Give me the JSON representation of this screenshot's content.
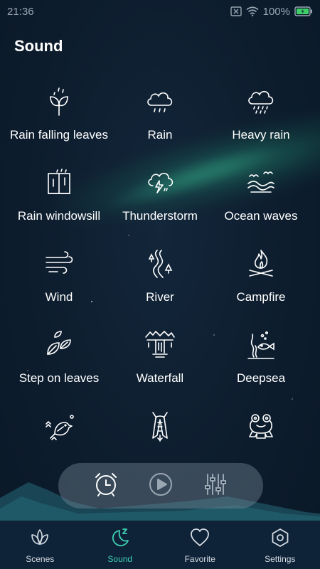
{
  "status_bar": {
    "time": "21:36",
    "battery": "100%"
  },
  "page_title": "Sound",
  "sounds": [
    {
      "label": "Rain falling leaves",
      "icon": "rain-leaves-icon"
    },
    {
      "label": "Rain",
      "icon": "rain-cloud-icon"
    },
    {
      "label": "Heavy rain",
      "icon": "heavy-rain-cloud-icon"
    },
    {
      "label": "Rain windowsill",
      "icon": "window-rain-icon"
    },
    {
      "label": "Thunderstorm",
      "icon": "thunderstorm-icon"
    },
    {
      "label": "Ocean waves",
      "icon": "waves-birds-icon"
    },
    {
      "label": "Wind",
      "icon": "wind-icon"
    },
    {
      "label": "River",
      "icon": "river-icon"
    },
    {
      "label": "Campfire",
      "icon": "campfire-icon"
    },
    {
      "label": "Step on leaves",
      "icon": "leaves-icon"
    },
    {
      "label": "Waterfall",
      "icon": "waterfall-icon"
    },
    {
      "label": "Deepsea",
      "icon": "deepsea-icon"
    },
    {
      "label": "",
      "icon": "bird-icon"
    },
    {
      "label": "",
      "icon": "cicada-icon"
    },
    {
      "label": "",
      "icon": "frog-icon"
    }
  ],
  "player": {
    "alarm_icon": "alarm-clock-icon",
    "play_icon": "play-icon",
    "mixer_icon": "mixer-icon"
  },
  "nav": [
    {
      "label": "Scenes",
      "icon": "lotus-icon",
      "active": false
    },
    {
      "label": "Sound",
      "icon": "moon-sleep-icon",
      "active": true
    },
    {
      "label": "Favorite",
      "icon": "heart-icon",
      "active": false
    },
    {
      "label": "Settings",
      "icon": "hexagon-gear-icon",
      "active": false
    }
  ],
  "colors": {
    "background": "#0c1c2d",
    "accent": "#3fd2b3",
    "nav_background": "#0e2238"
  }
}
